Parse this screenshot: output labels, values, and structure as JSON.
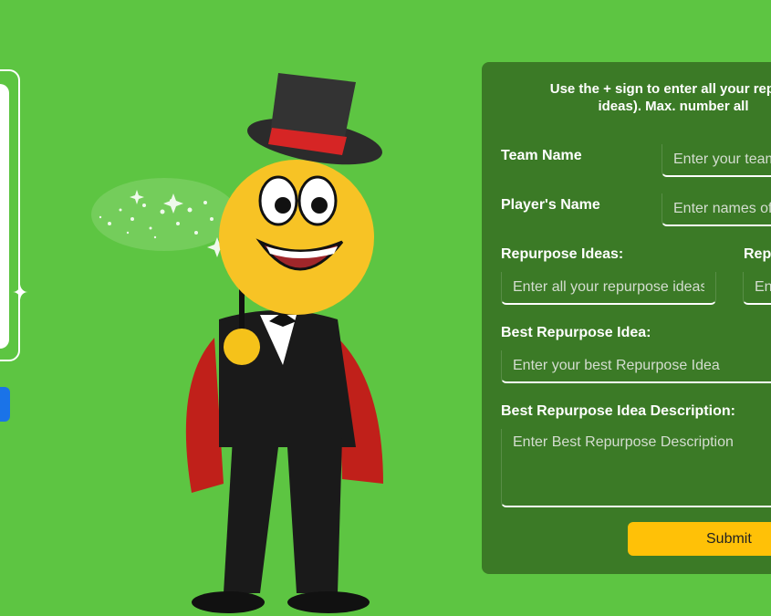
{
  "form": {
    "instructions": "Use the + sign to enter all your repurp\nideas). Max. number all",
    "team_name_label": "Team Name",
    "team_name_placeholder": "Enter your team",
    "players_name_label": "Player's Name",
    "players_name_placeholder": "Enter names of",
    "repurpose_ideas_label": "Repurpose Ideas:",
    "repurpose_ideas_placeholder": "Enter all your repurpose ideas",
    "repurpose_ideas_2_label": "Repu",
    "repurpose_ideas_2_placeholder": "En",
    "best_idea_label": "Best Repurpose Idea:",
    "best_idea_placeholder": "Enter your best Repurpose Idea",
    "best_desc_label": "Best Repurpose Idea Description:",
    "best_desc_placeholder": "Enter Best Repurpose Description",
    "submit_label": "Submit"
  },
  "colors": {
    "background": "#5dc542",
    "panel": "#3b7a26",
    "submit": "#ffc107",
    "left_button": "#1a73e8"
  },
  "icons": {
    "left_sparkle": "sparkle-icon",
    "mascot": "magician-mascot-illustration"
  }
}
